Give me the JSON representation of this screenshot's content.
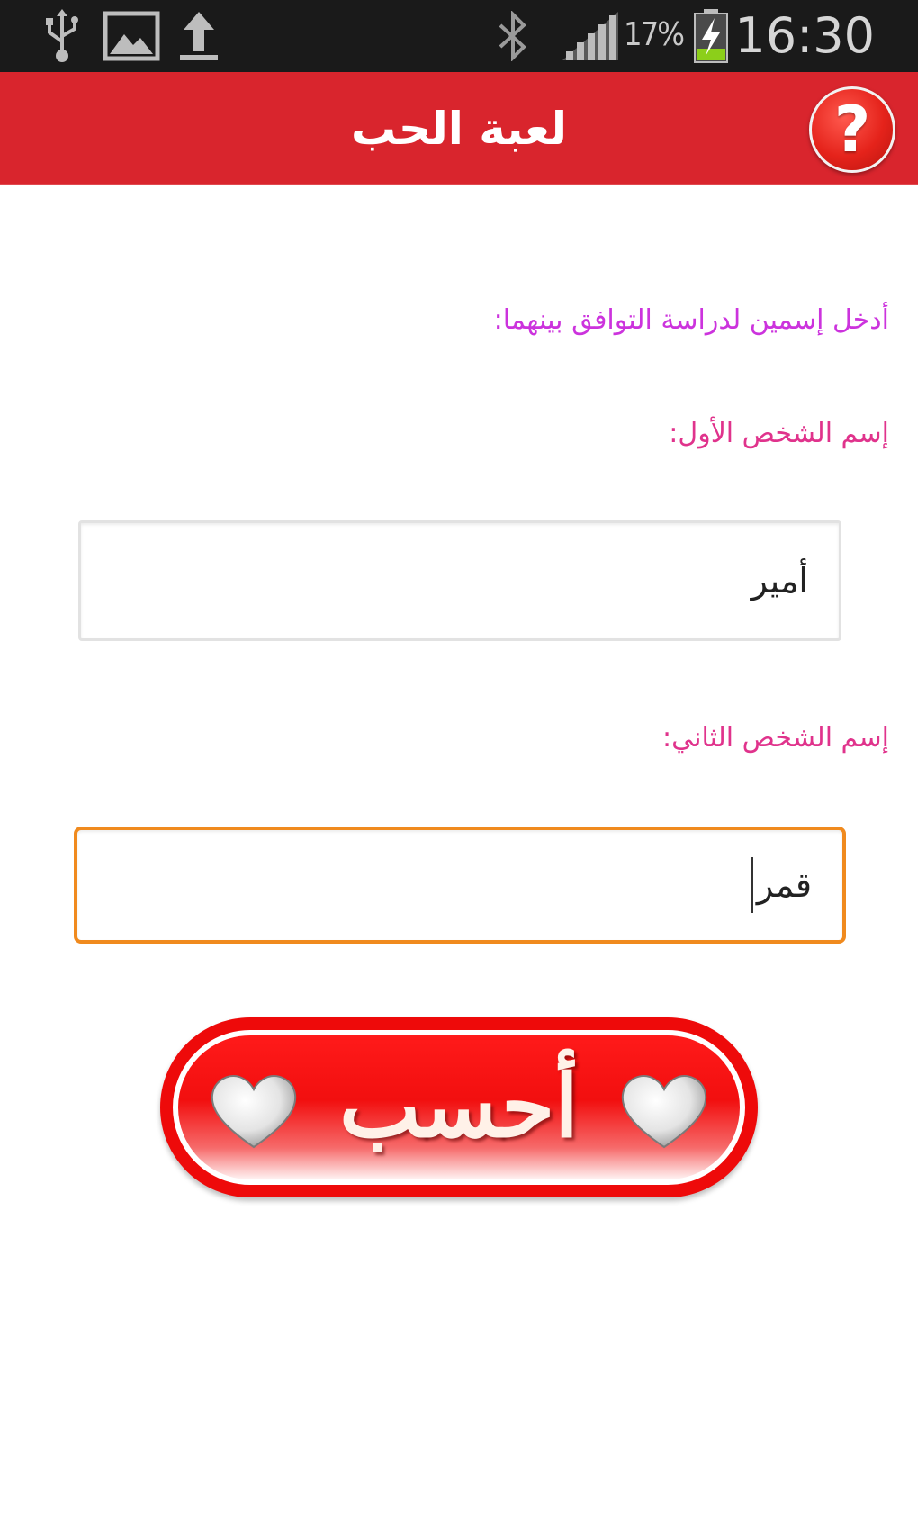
{
  "status_bar": {
    "time": "16:30",
    "battery_percent": "17%",
    "icons": [
      "usb-icon",
      "image-icon",
      "upload-icon",
      "bluetooth-icon",
      "signal-icon",
      "battery-charging-icon"
    ]
  },
  "action_bar": {
    "title": "لعبة الحب",
    "help_icon": "?"
  },
  "form": {
    "intro": "أدخل إسمين لدراسة التوافق بينهما:",
    "first_label": "إسم الشخص الأول:",
    "first_value": "أمير",
    "second_label": "إسم الشخص الثاني:",
    "second_value": "قمر"
  },
  "calc_button": {
    "label": "أحسب",
    "icon": "heart-icon"
  },
  "colors": {
    "action_bar": "#d9252d",
    "intro_text": "#cc33dd",
    "label_text": "#e0338c",
    "focus_border": "#f08a1e",
    "button_red": "#ee0a0a"
  }
}
